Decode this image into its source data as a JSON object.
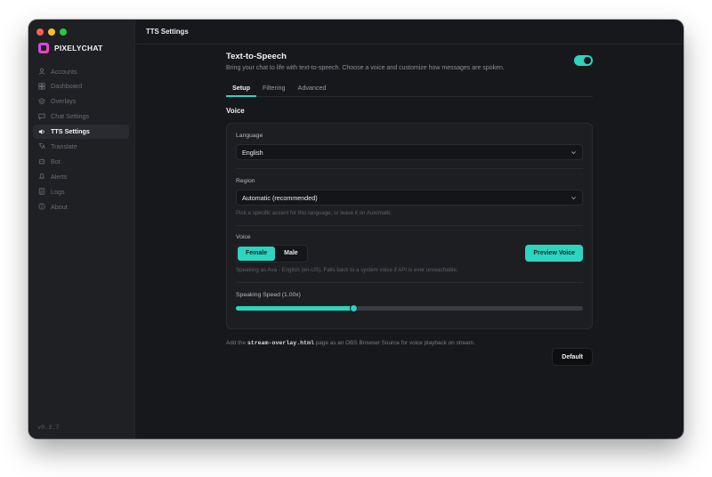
{
  "app": {
    "brand": "PIXELYCHAT",
    "version": "v0.3.7",
    "window_title": "TTS Settings"
  },
  "sidebar": {
    "items": [
      {
        "label": "Accounts",
        "icon": "user-icon",
        "active": false
      },
      {
        "label": "Dashboard",
        "icon": "dashboard-icon",
        "active": false
      },
      {
        "label": "Overlays",
        "icon": "layers-icon",
        "active": false
      },
      {
        "label": "Chat Settings",
        "icon": "chat-icon",
        "active": false
      },
      {
        "label": "TTS Settings",
        "icon": "speaker-icon",
        "active": true
      },
      {
        "label": "Translate",
        "icon": "translate-icon",
        "active": false
      },
      {
        "label": "Bot",
        "icon": "bot-icon",
        "active": false
      },
      {
        "label": "Alerts",
        "icon": "bell-icon",
        "active": false
      },
      {
        "label": "Logs",
        "icon": "logs-icon",
        "active": false
      },
      {
        "label": "About",
        "icon": "info-icon",
        "active": false
      }
    ]
  },
  "header": {
    "title": "Text-to-Speech",
    "description": "Bring your chat to life with text-to-speech. Choose a voice and customize how messages are spoken.",
    "enabled": true
  },
  "tabs": [
    {
      "label": "Setup",
      "active": true
    },
    {
      "label": "Filtering",
      "active": false
    },
    {
      "label": "Advanced",
      "active": false
    }
  ],
  "voice_section": {
    "title": "Voice",
    "language": {
      "label": "Language",
      "value": "English"
    },
    "region": {
      "label": "Region",
      "value": "Automatic (recommended)",
      "hint": "Pick a specific accent for this language, or leave it on Automatic."
    },
    "voice": {
      "label": "Voice",
      "options": [
        "Female",
        "Male"
      ],
      "selected": "Female",
      "preview_label": "Preview Voice",
      "hint": "Speaking as Ava - English (en-US). Falls back to a system voice if API is ever unreachable."
    },
    "speed": {
      "label": "Speaking Speed (1.00x)",
      "fraction": 0.34
    }
  },
  "footer": {
    "note_prefix": "Add the",
    "note_code": "stream-overlay.html",
    "note_suffix": "page as an OBS Browser Source for voice playback on stream.",
    "default_label": "Default"
  },
  "colors": {
    "accent": "#2dd4bf",
    "background": "#17181b",
    "sidebar": "#1f2024"
  }
}
